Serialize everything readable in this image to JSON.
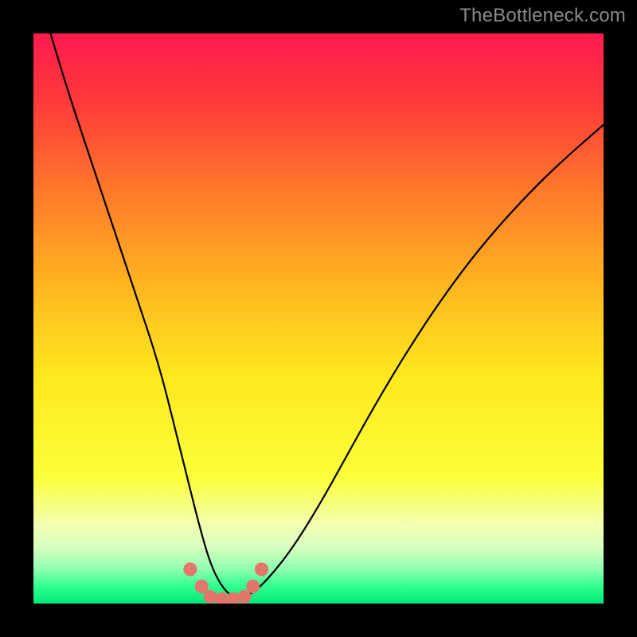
{
  "watermark": "TheBottleneck.com",
  "colors": {
    "frame_bg": "#000000",
    "watermark_text": "#8a8a8a",
    "curve_stroke": "#000000",
    "marker_fill": "#e2766c",
    "gradient_stops": [
      {
        "offset": 0.0,
        "color": "#ff1a4f"
      },
      {
        "offset": 0.12,
        "color": "#ff3a3b"
      },
      {
        "offset": 0.28,
        "color": "#ff7a2a"
      },
      {
        "offset": 0.45,
        "color": "#ffb820"
      },
      {
        "offset": 0.6,
        "color": "#ffe81e"
      },
      {
        "offset": 0.78,
        "color": "#fbff3a"
      },
      {
        "offset": 0.86,
        "color": "#f3ffb0"
      },
      {
        "offset": 0.9,
        "color": "#d9ffc0"
      },
      {
        "offset": 0.94,
        "color": "#8fffb0"
      },
      {
        "offset": 0.97,
        "color": "#30ff8f"
      },
      {
        "offset": 1.0,
        "color": "#00e878"
      }
    ]
  },
  "chart_data": {
    "type": "line",
    "title": "",
    "xlabel": "",
    "ylabel": "",
    "xlim": [
      0,
      100
    ],
    "ylim": [
      0,
      100
    ],
    "grid": false,
    "series": [
      {
        "name": "bottleneck-curve",
        "x": [
          3,
          6,
          10,
          14,
          18,
          22,
          25,
          27,
          29,
          31,
          33,
          35,
          37,
          40,
          45,
          50,
          55,
          60,
          66,
          72,
          78,
          85,
          92,
          100
        ],
        "y": [
          100,
          90,
          78,
          66,
          54,
          42,
          30,
          22,
          14,
          7,
          3,
          1,
          1,
          3,
          9,
          17,
          26,
          35,
          45,
          54,
          62,
          70,
          77,
          84
        ]
      }
    ],
    "markers": {
      "name": "highlight-dots",
      "x": [
        27.5,
        29.5,
        31.0,
        33.0,
        35.0,
        37.0,
        38.5,
        40.0
      ],
      "y": [
        6.0,
        3.0,
        1.2,
        0.8,
        0.8,
        1.2,
        3.0,
        6.0
      ],
      "r": 1.2
    }
  }
}
